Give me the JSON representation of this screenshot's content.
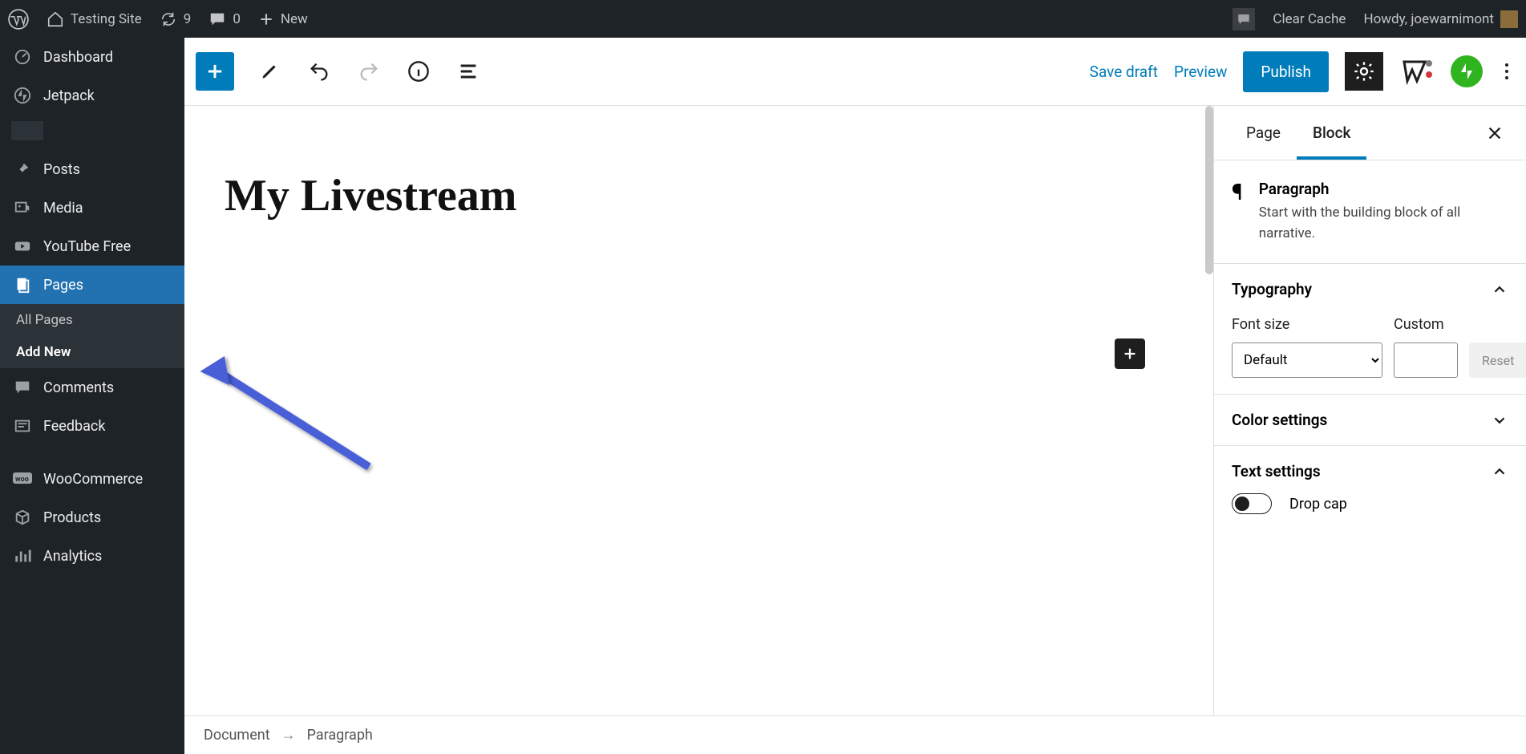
{
  "adminbar": {
    "site_name": "Testing Site",
    "updates_count": "9",
    "comments_count": "0",
    "new_label": "New",
    "clear_cache": "Clear Cache",
    "howdy": "Howdy, joewarnimont"
  },
  "sidebar": {
    "items": [
      {
        "label": "Dashboard"
      },
      {
        "label": "Jetpack"
      },
      {
        "label": "Posts"
      },
      {
        "label": "Media"
      },
      {
        "label": "YouTube Free"
      },
      {
        "label": "Pages"
      },
      {
        "label": "Comments"
      },
      {
        "label": "Feedback"
      },
      {
        "label": "WooCommerce"
      },
      {
        "label": "Products"
      },
      {
        "label": "Analytics"
      }
    ],
    "submenu": {
      "all": "All Pages",
      "add": "Add New"
    }
  },
  "editor_header": {
    "save_draft": "Save draft",
    "preview": "Preview",
    "publish": "Publish"
  },
  "canvas": {
    "title": "My Livestream"
  },
  "settings": {
    "tabs": {
      "page": "Page",
      "block": "Block"
    },
    "block": {
      "name": "Paragraph",
      "description": "Start with the building block of all narrative."
    },
    "typography": {
      "heading": "Typography",
      "font_size_label": "Font size",
      "custom_label": "Custom",
      "default_option": "Default",
      "reset": "Reset"
    },
    "color": {
      "heading": "Color settings"
    },
    "text": {
      "heading": "Text settings",
      "drop_cap": "Drop cap"
    }
  },
  "breadcrumb": {
    "root": "Document",
    "current": "Paragraph"
  }
}
